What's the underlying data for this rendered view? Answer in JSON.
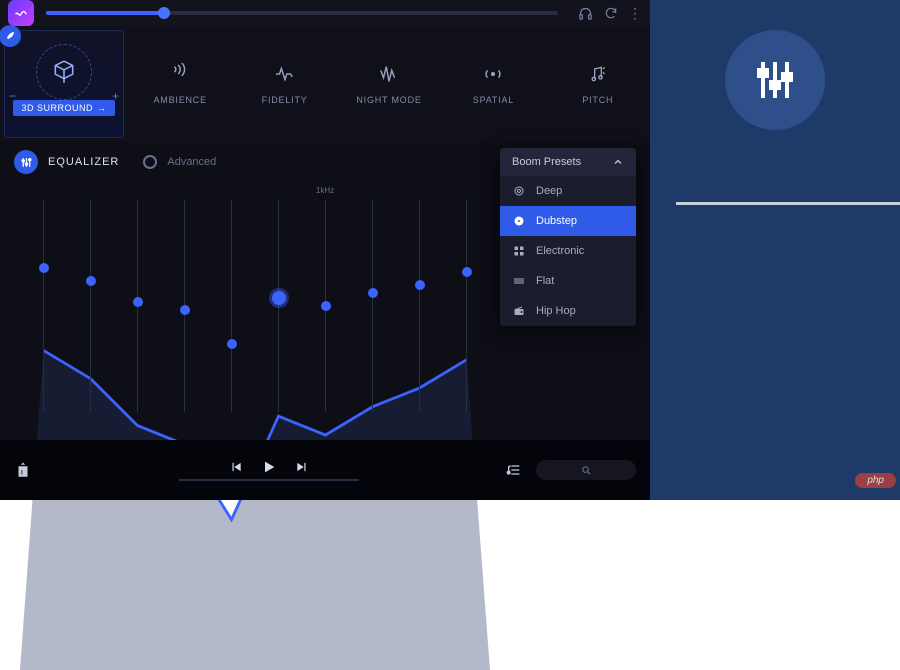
{
  "header": {
    "volume_percent": 23
  },
  "effects": {
    "main_label": "3D SURROUND",
    "items": [
      {
        "id": "ambience",
        "label": "AMBIENCE"
      },
      {
        "id": "fidelity",
        "label": "FIDELITY"
      },
      {
        "id": "nightmode",
        "label": "NIGHT MODE"
      },
      {
        "id": "spatial",
        "label": "SPATIAL"
      },
      {
        "id": "pitch",
        "label": "PITCH"
      }
    ]
  },
  "equalizer": {
    "title": "EQUALIZER",
    "advanced_label": "Advanced",
    "center_freq_label": "1kHz",
    "bands": [
      {
        "value": 68
      },
      {
        "value": 62
      },
      {
        "value": 52
      },
      {
        "value": 48
      },
      {
        "value": 32
      },
      {
        "value": 54,
        "active": true
      },
      {
        "value": 50
      },
      {
        "value": 56
      },
      {
        "value": 60
      },
      {
        "value": 66
      }
    ]
  },
  "presets": {
    "header": "Boom Presets",
    "items": [
      {
        "id": "deep",
        "label": "Deep",
        "icon": "circle-icon"
      },
      {
        "id": "dubstep",
        "label": "Dubstep",
        "icon": "disc-icon",
        "selected": true
      },
      {
        "id": "electronic",
        "label": "Electronic",
        "icon": "grid-icon"
      },
      {
        "id": "flat",
        "label": "Flat",
        "icon": "bars-icon"
      },
      {
        "id": "hiphop",
        "label": "Hip Hop",
        "icon": "radio-icon"
      }
    ]
  },
  "footer": {
    "search_placeholder": ""
  },
  "sidepanel": {
    "badge": "php"
  }
}
